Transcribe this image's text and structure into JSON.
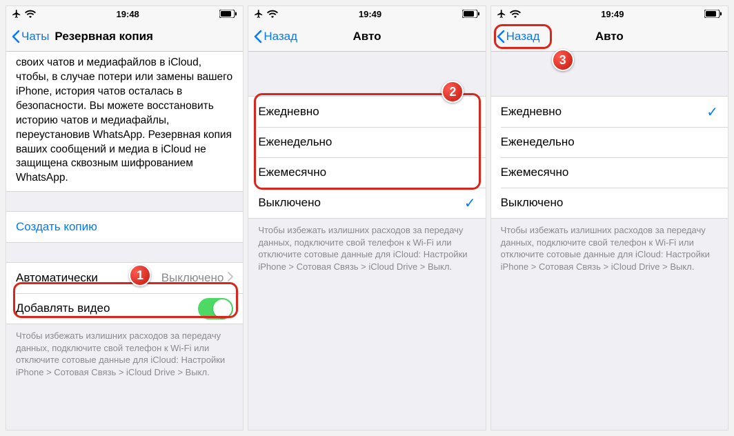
{
  "screens": [
    {
      "status": {
        "time": "19:48"
      },
      "nav": {
        "back": "Чаты",
        "title": "Резервная копия"
      },
      "info": "своих чатов и медиафайлов в iCloud, чтобы, в случае потери или замены вашего iPhone, история чатов осталась в безопасности. Вы можете восстановить историю чатов и медиафайлы, переустановив WhatsApp. Резервная копия ваших сообщений и медиа в iCloud не защищена сквозным шифрованием WhatsApp.",
      "create_backup": "Создать копию",
      "auto_row": {
        "label": "Автоматически",
        "value": "Выключено"
      },
      "video_row": {
        "label": "Добавлять видео"
      },
      "footer": "Чтобы избежать излишних расходов за передачу данных, подключите свой телефон к Wi-Fi или отключите сотовые данные для iCloud: Настройки iPhone > Сотовая Связь > iCloud Drive > Выкл.",
      "badge": "1"
    },
    {
      "status": {
        "time": "19:49"
      },
      "nav": {
        "back": "Назад",
        "title": "Авто"
      },
      "options": [
        {
          "label": "Ежедневно",
          "checked": false
        },
        {
          "label": "Еженедельно",
          "checked": false
        },
        {
          "label": "Ежемесячно",
          "checked": false
        }
      ],
      "off_option": {
        "label": "Выключено",
        "checked": true
      },
      "footer": "Чтобы избежать излишних расходов за передачу данных, подключите свой телефон к Wi-Fi или отключите сотовые данные для iCloud: Настройки iPhone > Сотовая Связь > iCloud Drive > Выкл.",
      "badge": "2"
    },
    {
      "status": {
        "time": "19:49"
      },
      "nav": {
        "back": "Назад",
        "title": "Авто"
      },
      "options": [
        {
          "label": "Ежедневно",
          "checked": true
        },
        {
          "label": "Еженедельно",
          "checked": false
        },
        {
          "label": "Ежемесячно",
          "checked": false
        }
      ],
      "off_option": {
        "label": "Выключено",
        "checked": false
      },
      "footer": "Чтобы избежать излишних расходов за передачу данных, подключите свой телефон к Wi-Fi или отключите сотовые данные для iCloud: Настройки iPhone > Сотовая Связь > iCloud Drive > Выкл.",
      "badge": "3"
    }
  ]
}
